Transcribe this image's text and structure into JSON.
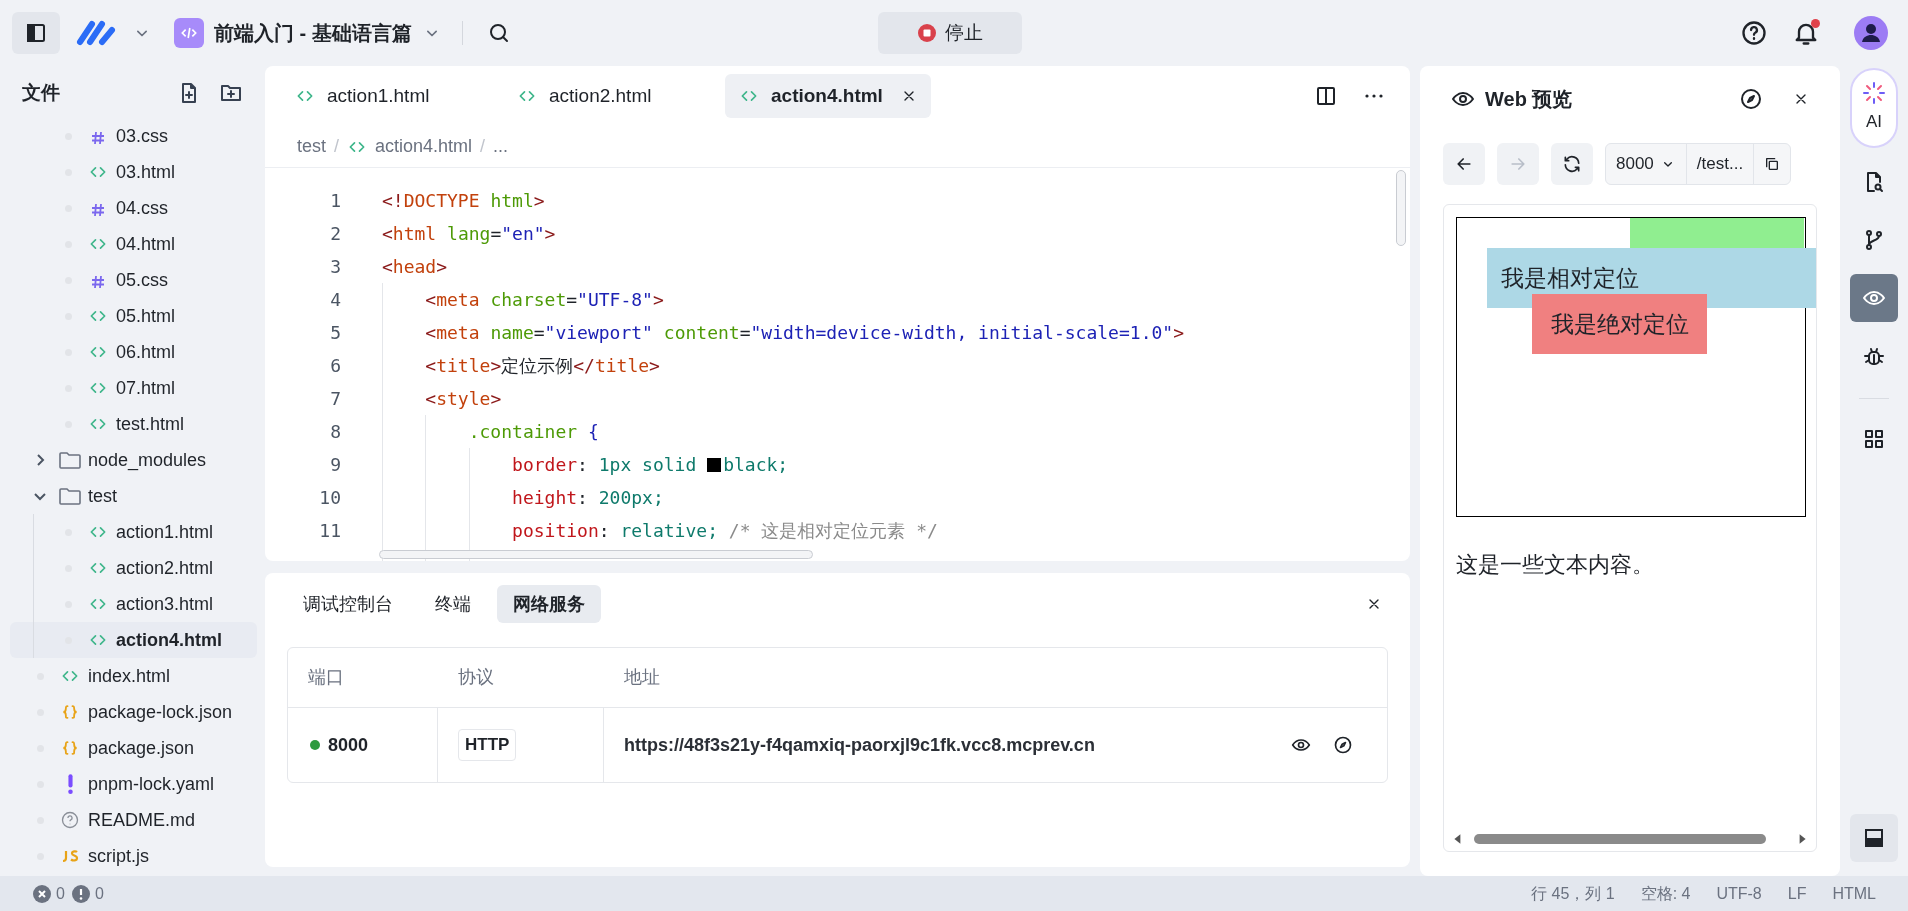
{
  "topbar": {
    "project_title": "前端入门 - 基础语言篇",
    "stop_button": "停止",
    "notification_unread": true
  },
  "sidebar": {
    "title": "文件",
    "continued_children": [
      {
        "name": "03.css",
        "kind": "css",
        "selected": false
      },
      {
        "name": "03.html",
        "kind": "html",
        "selected": false
      },
      {
        "name": "04.css",
        "kind": "css",
        "selected": false
      },
      {
        "name": "04.html",
        "kind": "html",
        "selected": false
      },
      {
        "name": "05.css",
        "kind": "css",
        "selected": false
      },
      {
        "name": "05.html",
        "kind": "html",
        "selected": false
      },
      {
        "name": "06.html",
        "kind": "html",
        "selected": false
      },
      {
        "name": "07.html",
        "kind": "html",
        "selected": false
      },
      {
        "name": "test.html",
        "kind": "html",
        "selected": false
      }
    ],
    "items": [
      {
        "name": "node_modules",
        "kind": "folder",
        "expanded": false,
        "selected": false
      },
      {
        "name": "test",
        "kind": "folder",
        "expanded": true,
        "selected": false,
        "children": [
          {
            "name": "action1.html",
            "kind": "html",
            "selected": false
          },
          {
            "name": "action2.html",
            "kind": "html",
            "selected": false
          },
          {
            "name": "action3.html",
            "kind": "html",
            "selected": false
          },
          {
            "name": "action4.html",
            "kind": "html",
            "selected": true
          }
        ]
      },
      {
        "name": "index.html",
        "kind": "html",
        "selected": false
      },
      {
        "name": "package-lock.json",
        "kind": "json",
        "selected": false
      },
      {
        "name": "package.json",
        "kind": "json",
        "selected": false
      },
      {
        "name": "pnpm-lock.yaml",
        "kind": "yaml",
        "selected": false
      },
      {
        "name": "README.md",
        "kind": "md",
        "selected": false
      },
      {
        "name": "script.js",
        "kind": "js",
        "selected": false
      }
    ]
  },
  "editor": {
    "tabs": [
      {
        "label": "action1.html",
        "selected": false
      },
      {
        "label": "action2.html",
        "selected": false
      },
      {
        "label": "action4.html",
        "selected": true
      }
    ],
    "breadcrumb_separator": "/",
    "breadcrumb": [
      {
        "kind": "folder",
        "text": "test"
      },
      {
        "kind": "html",
        "text": "action4.html"
      },
      {
        "kind": "more",
        "text": "..."
      }
    ],
    "code_lines": [
      {
        "number": "1",
        "tokens": [
          {
            "kind": "punct",
            "text": "<!"
          },
          {
            "kind": "tag",
            "text": "DOCTYPE"
          },
          {
            "kind": "attr",
            "text": " html"
          },
          {
            "kind": "punct",
            "text": ">"
          }
        ]
      },
      {
        "number": "2",
        "tokens": [
          {
            "kind": "punct",
            "text": "<"
          },
          {
            "kind": "tag",
            "text": "html"
          },
          {
            "kind": "attr",
            "text": " lang"
          },
          {
            "kind": "plain",
            "text": "="
          },
          {
            "kind": "value",
            "text": "\"en\""
          },
          {
            "kind": "punct",
            "text": ">"
          }
        ]
      },
      {
        "number": "3",
        "tokens": [
          {
            "kind": "punct",
            "text": "<"
          },
          {
            "kind": "tag",
            "text": "head"
          },
          {
            "kind": "punct",
            "text": ">"
          }
        ]
      },
      {
        "number": "4",
        "tokens": [
          {
            "kind": "punct",
            "text": "    <"
          },
          {
            "kind": "tag",
            "text": "meta"
          },
          {
            "kind": "attr",
            "text": " charset"
          },
          {
            "kind": "plain",
            "text": "="
          },
          {
            "kind": "value",
            "text": "\"UTF-8\""
          },
          {
            "kind": "punct",
            "text": ">"
          }
        ]
      },
      {
        "number": "5",
        "tokens": [
          {
            "kind": "punct",
            "text": "    <"
          },
          {
            "kind": "tag",
            "text": "meta"
          },
          {
            "kind": "attr",
            "text": " name"
          },
          {
            "kind": "plain",
            "text": "="
          },
          {
            "kind": "value",
            "text": "\"viewport\""
          },
          {
            "kind": "attr",
            "text": " content"
          },
          {
            "kind": "plain",
            "text": "="
          },
          {
            "kind": "value",
            "text": "\"width=device-width, initial-scale=1.0\""
          },
          {
            "kind": "punct",
            "text": ">"
          }
        ]
      },
      {
        "number": "6",
        "tokens": [
          {
            "kind": "punct",
            "text": "    <"
          },
          {
            "kind": "tag",
            "text": "title"
          },
          {
            "kind": "punct",
            "text": ">"
          },
          {
            "kind": "plain",
            "text": "定位示例"
          },
          {
            "kind": "punct",
            "text": "</"
          },
          {
            "kind": "tag",
            "text": "title"
          },
          {
            "kind": "punct",
            "text": ">"
          }
        ]
      },
      {
        "number": "7",
        "tokens": [
          {
            "kind": "punct",
            "text": "    <"
          },
          {
            "kind": "tag",
            "text": "style"
          },
          {
            "kind": "punct",
            "text": ">"
          }
        ]
      },
      {
        "number": "8",
        "tokens": [
          {
            "kind": "selector",
            "text": "        .container"
          },
          {
            "kind": "brace",
            "text": " {"
          }
        ]
      },
      {
        "number": "9",
        "tokens": [
          {
            "kind": "prop",
            "text": "            border"
          },
          {
            "kind": "plain",
            "text": ": "
          },
          {
            "kind": "cssval",
            "text": "1px solid "
          },
          {
            "kind": "swatch",
            "color": "#000000"
          },
          {
            "kind": "cssval",
            "text": "black;"
          }
        ]
      },
      {
        "number": "10",
        "tokens": [
          {
            "kind": "prop",
            "text": "            height"
          },
          {
            "kind": "plain",
            "text": ": "
          },
          {
            "kind": "cssval",
            "text": "200px;"
          }
        ]
      },
      {
        "number": "11",
        "tokens": [
          {
            "kind": "prop",
            "text": "            position"
          },
          {
            "kind": "plain",
            "text": ": "
          },
          {
            "kind": "cssval",
            "text": "relative; "
          },
          {
            "kind": "comment",
            "text": "/* 这是相对定位元素 */"
          }
        ]
      }
    ]
  },
  "bottom_panel": {
    "tabs": [
      {
        "label": "调试控制台",
        "selected": false
      },
      {
        "label": "终端",
        "selected": false
      },
      {
        "label": "网络服务",
        "selected": true
      }
    ],
    "table": {
      "columns": [
        "端口",
        "协议",
        "地址"
      ],
      "rows": [
        {
          "port": "8000",
          "online": true,
          "protocol": "HTTP",
          "address": "https://48f3s21y-f4qamxiq-paorxjl9c1fk.vcc8.mcprev.cn"
        }
      ]
    }
  },
  "preview": {
    "title": "Web 预览",
    "forward_disabled": true,
    "port": "8000",
    "path": "/test...",
    "page": {
      "relative_text": "我是相对定位",
      "absolute_text": "我是绝对定位",
      "paragraph": "这是一些文本内容。"
    }
  },
  "right_rail": {
    "ai_label": "AI",
    "tools": [
      {
        "kind": "file-search",
        "selected": false
      },
      {
        "kind": "branch",
        "selected": false
      },
      {
        "kind": "preview",
        "selected": true
      },
      {
        "kind": "bug",
        "selected": false
      },
      {
        "kind": "grid",
        "selected": false
      }
    ]
  },
  "status_bar": {
    "errors": "0",
    "warnings": "0",
    "position": "行 45，列 1",
    "indent": "空格: 4",
    "encoding": "UTF-8",
    "eol": "LF",
    "language": "HTML"
  }
}
